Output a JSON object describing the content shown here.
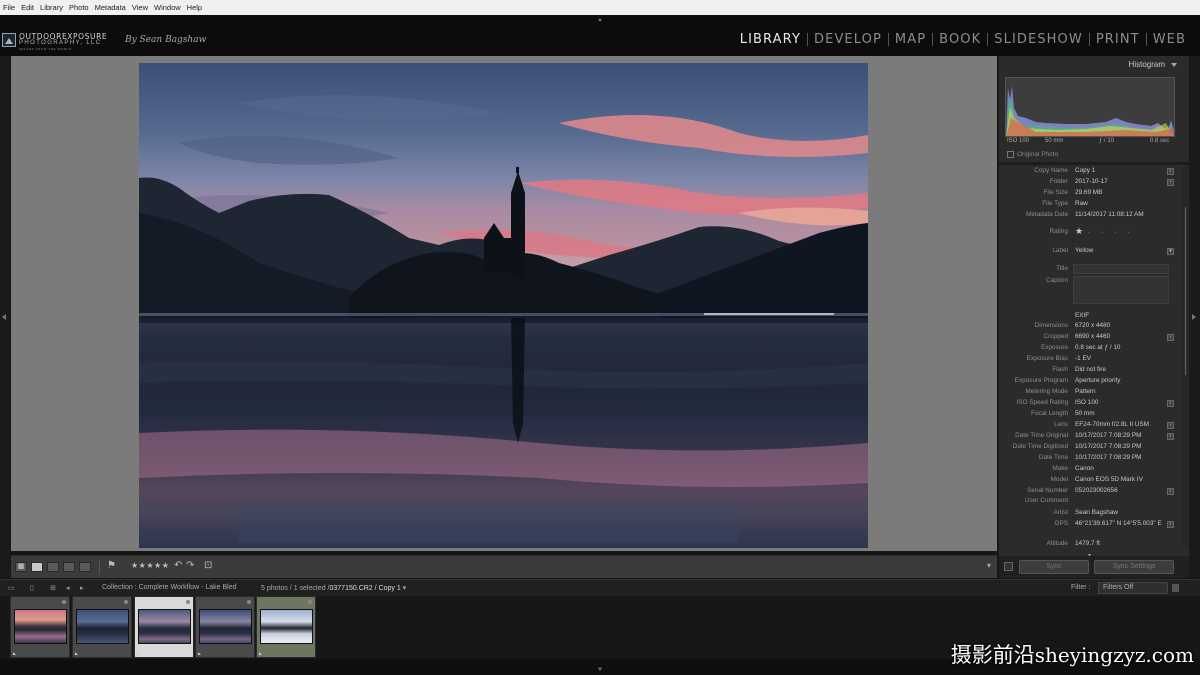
{
  "menubar": [
    "File",
    "Edit",
    "Library",
    "Photo",
    "Metadata",
    "View",
    "Window",
    "Help"
  ],
  "identity": {
    "logo_main": "OUTDOOREXPOSURE",
    "logo_sub": "PHOTOGRAPHY, LLC",
    "logo_tag": "IMAGES FROM THE WORLD",
    "by_line": "By Sean Bagshaw"
  },
  "modules": [
    "Library",
    "Develop",
    "Map",
    "Book",
    "Slideshow",
    "Print",
    "Web"
  ],
  "active_module": "Library",
  "toolbar": {
    "rating_stars": "★★★★★"
  },
  "histogram": {
    "title": "Histogram",
    "iso": "ISO 100",
    "focal": "50 mm",
    "aperture": "ƒ / 10",
    "shutter": "0.8 sec",
    "original_photo": "Original Photo"
  },
  "metadata": {
    "copy_name": {
      "label": "Copy Name",
      "value": "Copy 1"
    },
    "folder": {
      "label": "Folder",
      "value": "2017-10-17"
    },
    "file_size": {
      "label": "File Size",
      "value": "29.69 MB"
    },
    "file_type": {
      "label": "File Type",
      "value": "Raw"
    },
    "metadata_date": {
      "label": "Metadata Date",
      "value": "11/14/2017 11:08:12 AM"
    },
    "rating": {
      "label": "Rating",
      "value": 1,
      "max": 5
    },
    "label": {
      "label": "Label",
      "value": "Yellow"
    },
    "title": {
      "label": "Title",
      "value": ""
    },
    "caption": {
      "label": "Caption",
      "value": ""
    },
    "exif": "EXIF",
    "dimensions": {
      "label": "Dimensions",
      "value": "6720 x 4480"
    },
    "cropped": {
      "label": "Cropped",
      "value": "6690 x 4460"
    },
    "exposure": {
      "label": "Exposure",
      "value": "0.8 sec at ƒ / 10"
    },
    "exposure_bias": {
      "label": "Exposure Bias",
      "value": "-1 EV"
    },
    "flash": {
      "label": "Flash",
      "value": "Did not fire"
    },
    "exposure_program": {
      "label": "Exposure Program",
      "value": "Aperture priority"
    },
    "metering_mode": {
      "label": "Metering Mode",
      "value": "Pattern"
    },
    "iso_speed": {
      "label": "ISO Speed Rating",
      "value": "ISO 100"
    },
    "focal_length": {
      "label": "Focal Length",
      "value": "50 mm"
    },
    "lens": {
      "label": "Lens",
      "value": "EF24-70mm f/2.8L II USM"
    },
    "date_time_original": {
      "label": "Date Time Original",
      "value": "10/17/2017 7:08:29 PM"
    },
    "date_time_digitized": {
      "label": "Date Time Digitized",
      "value": "10/17/2017 7:08:29 PM"
    },
    "date_time": {
      "label": "Date Time",
      "value": "10/17/2017 7:08:29 PM"
    },
    "make": {
      "label": "Make",
      "value": "Canon"
    },
    "model": {
      "label": "Model",
      "value": "Canon EOS 5D Mark IV"
    },
    "serial_number": {
      "label": "Serial Number",
      "value": "052023002656"
    },
    "user_comment": {
      "label": "User Comment",
      "value": ""
    },
    "artist": {
      "label": "Artist",
      "value": "Sean Bagshaw"
    },
    "gps": {
      "label": "GPS",
      "value": "46°21'39.617\" N 14°5'5.003\" E"
    },
    "altitude": {
      "label": "Altitude",
      "value": "1479.7 ft"
    }
  },
  "sync": {
    "sync_label": "Sync",
    "sync_settings_label": "Sync Settings"
  },
  "filmstrip_bar": {
    "collection": "Collection : Complete Workflow - Lake Bled",
    "selection_prefix": "5 photos / 1 selected /",
    "selection_file": "0377150.CR2 / Copy 1",
    "filter_label": "Filter :",
    "filter_value": "Filters Off"
  },
  "thumbnails": [
    {
      "selected": false,
      "tone": "warm"
    },
    {
      "selected": false,
      "tone": "blue"
    },
    {
      "selected": true,
      "tone": "dusk"
    },
    {
      "selected": false,
      "tone": "dusk"
    },
    {
      "selected": false,
      "tone": "bright"
    }
  ],
  "watermark": {
    "cn": "摄影前沿",
    "domain": "sheyingzyz.com"
  }
}
